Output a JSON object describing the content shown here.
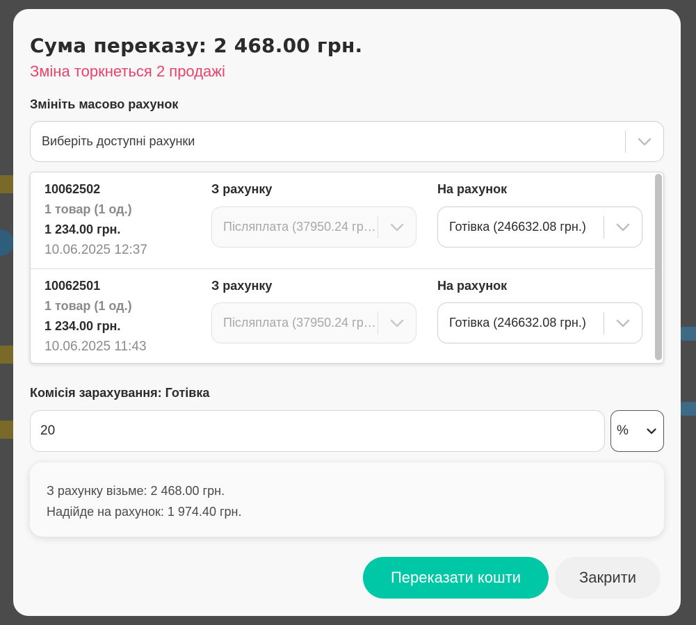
{
  "modal": {
    "title": "Сума переказу: 2 468.00 грн.",
    "subtitle": "Зміна торкнеться 2 продажі",
    "bulk_account_label": "Змініть масово рахунок",
    "bulk_account_placeholder": "Виберіть доступні рахунки",
    "sales": [
      {
        "id": "10062502",
        "items": "1 товар (1 од.)",
        "amount": "1 234.00 грн.",
        "date": "10.06.2025 12:37",
        "from_label": "З рахунку",
        "from_value": "Післяплата (37950.24 грн.)",
        "to_label": "На рахунок",
        "to_value": "Готівка (246632.08 грн.)"
      },
      {
        "id": "10062501",
        "items": "1 товар (1 од.)",
        "amount": "1 234.00 грн.",
        "date": "10.06.2025 11:43",
        "from_label": "З рахунку",
        "from_value": "Післяплата (37950.24 грн.)",
        "to_label": "На рахунок",
        "to_value": "Готівка (246632.08 грн.)"
      }
    ],
    "commission_label": "Комісія зарахування: Готівка",
    "commission_value": "20",
    "commission_unit": "%",
    "summary": {
      "take_from": "З рахунку візьме: 2 468.00 грн.",
      "arrive_to": "Надійде на рахунок: 1 974.40 грн."
    },
    "transfer_button": "Переказати кошти",
    "close_button": "Закрити"
  },
  "colors": {
    "accent": "#00c7a5",
    "warning_text": "#e8436c"
  }
}
